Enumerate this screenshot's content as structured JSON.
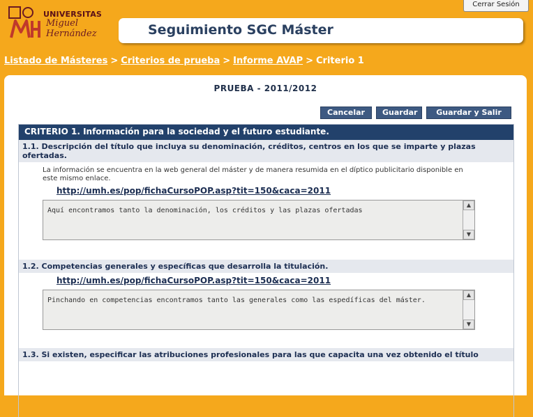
{
  "header": {
    "logout_label": "Cerrar Sesión",
    "logo_line1": "UNIVERSITAS",
    "logo_line2": "Miguel",
    "logo_line3": "Hernández",
    "app_title": "Seguimiento SGC Máster"
  },
  "breadcrumb": {
    "item1": "Listado de Másteres",
    "item2": "Criterios de prueba",
    "item3": "Informe AVAP",
    "current": "Criterio 1",
    "separator": ">"
  },
  "page": {
    "year_title": "PRUEBA - 2011/2012"
  },
  "actions": {
    "cancel": "Cancelar",
    "save": "Guardar",
    "save_exit": "Guardar y Salir"
  },
  "criterion": {
    "title": "CRITERIO 1. Información para la sociedad y el futuro estudiante.",
    "items": [
      {
        "title": "1.1. Descripción del título que incluya su denominación, créditos, centros en los que se imparte y plazas ofertadas.",
        "info": "La información se encuentra en la web general del máster y de manera resumida en el díptico publicitario disponible en este mismo enlace.",
        "link": "http://umh.es/pop/fichaCursoPOP.asp?tit=150&caca=2011",
        "text": "Aquí encontramos tanto la denominación, los créditos y las plazas ofertadas"
      },
      {
        "title": "1.2. Competencias generales y específicas que desarrolla la titulación.",
        "link": "http://umh.es/pop/fichaCursoPOP.asp?tit=150&caca=2011",
        "text": "Pinchando en competencias encontramos tanto las generales como las espedíficas del máster."
      },
      {
        "title": "1.3. Si existen, especificar las atribuciones profesionales para las que capacita una vez obtenido el título"
      }
    ]
  },
  "colors": {
    "background": "#f5a81c",
    "navy": "#22416b",
    "button": "#3e5a82"
  }
}
